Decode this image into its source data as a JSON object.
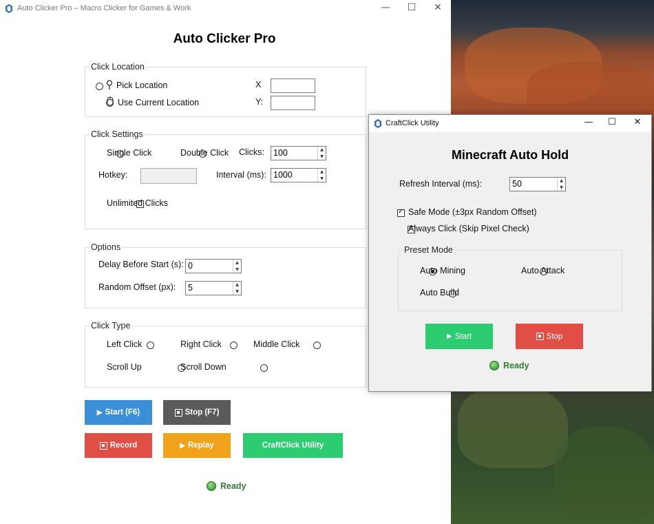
{
  "main_window": {
    "title": "Auto Clicker Pro – Macro Clicker for Games & Work",
    "heading": "Auto Clicker Pro",
    "controls": {
      "minimize": "—",
      "maximize": "☐",
      "close": "✕"
    }
  },
  "click_location": {
    "legend": "Click Location",
    "pick_label": "Pick Location",
    "current_label": "Use Current Location",
    "x_label": "X",
    "y_label": "Y:",
    "x_value": "",
    "y_value": ""
  },
  "click_settings": {
    "legend": "Click Settings",
    "single_label": "Single Click",
    "double_label": "Double Click",
    "clicks_label": "Clicks:",
    "clicks_value": "100",
    "hotkey_label": "Hotkey:",
    "hotkey_value": "",
    "interval_label": "Interval (ms):",
    "interval_value": "1000",
    "unlimited_label": "Unlimited Clicks"
  },
  "options": {
    "legend": "Options",
    "delay_label": "Delay Before Start (s):",
    "delay_value": "0",
    "offset_label": "Random Offset (px):",
    "offset_value": "5"
  },
  "click_type": {
    "legend": "Click Type",
    "left": "Left Click",
    "right": "Right Click",
    "middle": "Middle Click",
    "scroll_up": "Scroll Up",
    "scroll_down": "Scroll Down"
  },
  "buttons": {
    "start": "Start (F6)",
    "stop": "Stop (F7)",
    "record": "Record",
    "replay": "Replay",
    "craftclick": "CraftClick Utility"
  },
  "status": {
    "text": "Ready"
  },
  "utility_window": {
    "title": "CraftClick Utility",
    "heading": "Minecraft Auto Hold",
    "refresh_label": "Refresh Interval (ms):",
    "refresh_value": "50",
    "safe_mode_label": "Safe Mode (±3px Random Offset)",
    "safe_mode_checked": true,
    "always_click_label": "Always Click (Skip Pixel Check)",
    "always_click_checked": true,
    "preset_legend": "Preset Mode",
    "auto_mining": "Auto Mining",
    "auto_attack": "Auto Attack",
    "auto_build": "Auto Build",
    "selected_preset": "Auto Mining",
    "start": "Start",
    "stop": "Stop",
    "status": "Ready"
  },
  "colors": {
    "start_blue": "#3a8fd8",
    "stop_gray": "#5a5a5a",
    "record_red": "#e04e45",
    "replay_orange": "#f0a21a",
    "craft_green": "#2ecc71",
    "ready_green": "#2e7d32"
  }
}
